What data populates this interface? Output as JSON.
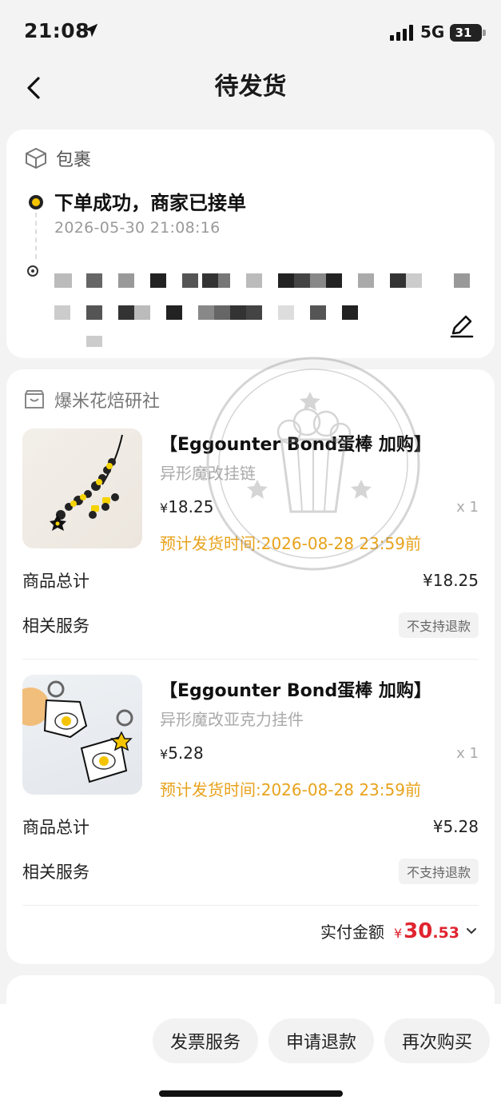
{
  "status_bar": {
    "time": "21:08",
    "network": "5G",
    "battery": "31"
  },
  "header": {
    "title": "待发货"
  },
  "parcel": {
    "label": "包裹",
    "status": "下单成功，商家已接单",
    "timestamp": "2026-05-30 21:08:16"
  },
  "shop": {
    "name": "爆米花焙研社",
    "items": [
      {
        "title": "【Eggounter Bond蛋棒 加购】",
        "spec": "异形魔改挂链",
        "price": "18.25",
        "currency": "¥",
        "qty": "x 1",
        "ship_time": "预计发货时间:2026-08-28 23:59前",
        "subtotal_label": "商品总计",
        "subtotal": "¥18.25",
        "service_label": "相关服务",
        "service_tag": "不支持退款"
      },
      {
        "title": "【Eggounter Bond蛋棒 加购】",
        "spec": "异形魔改亚克力挂件",
        "price": "5.28",
        "currency": "¥",
        "qty": "x 1",
        "ship_time": "预计发货时间:2026-08-28 23:59前",
        "subtotal_label": "商品总计",
        "subtotal": "¥5.28",
        "service_label": "相关服务",
        "service_tag": "不支持退款"
      }
    ],
    "paid_label": "实付金额",
    "paid_currency": "¥",
    "paid_int": "30",
    "paid_dec": ".53"
  },
  "actions": {
    "invoice": "发票服务",
    "refund": "申请退款",
    "rebuy": "再次购买"
  },
  "colors": {
    "accent_yellow": "#f5c400",
    "ship_orange": "#e8a21b",
    "price_red": "#e0242f"
  },
  "icons": [
    "location-arrow-icon",
    "signal-icon",
    "battery-icon",
    "back-chevron-icon",
    "package-icon",
    "location-pin-icon",
    "edit-pen-icon",
    "shop-icon",
    "chevron-down-icon"
  ]
}
